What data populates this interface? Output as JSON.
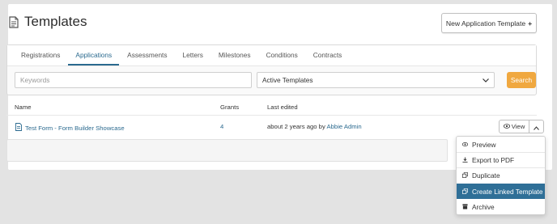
{
  "page": {
    "title": "Templates",
    "new_button": "New Application Template",
    "new_button_icon": "+"
  },
  "tabs": [
    {
      "label": "Registrations"
    },
    {
      "label": "Applications",
      "active": true
    },
    {
      "label": "Assessments"
    },
    {
      "label": "Letters"
    },
    {
      "label": "Milestones"
    },
    {
      "label": "Conditions"
    },
    {
      "label": "Contracts"
    }
  ],
  "filters": {
    "keywords_placeholder": "Keywords",
    "status_select": "Active Templates",
    "search_label": "Search"
  },
  "table": {
    "columns": [
      "Name",
      "Grants",
      "Last edited"
    ],
    "rows": [
      {
        "name": "Test Form - Form Builder Showcase",
        "grants": "4",
        "last_edited_prefix": "about 2 years ago by",
        "editor": "Abbie Admin",
        "view_label": "View"
      }
    ]
  },
  "dropdown": {
    "items": [
      {
        "label": "Preview",
        "icon": "eye-icon"
      },
      {
        "label": "Export to PDF",
        "icon": "download-icon"
      },
      {
        "label": "Duplicate",
        "icon": "copy-icon"
      },
      {
        "label": "Create Linked Template",
        "icon": "copy-icon",
        "selected": true
      },
      {
        "label": "Archive",
        "icon": "archive-icon"
      }
    ]
  },
  "colors": {
    "accent": "#2b6a8f",
    "search_button": "#f0a840",
    "selected_item": "#2f6f97",
    "background": "#e3e3e3"
  }
}
